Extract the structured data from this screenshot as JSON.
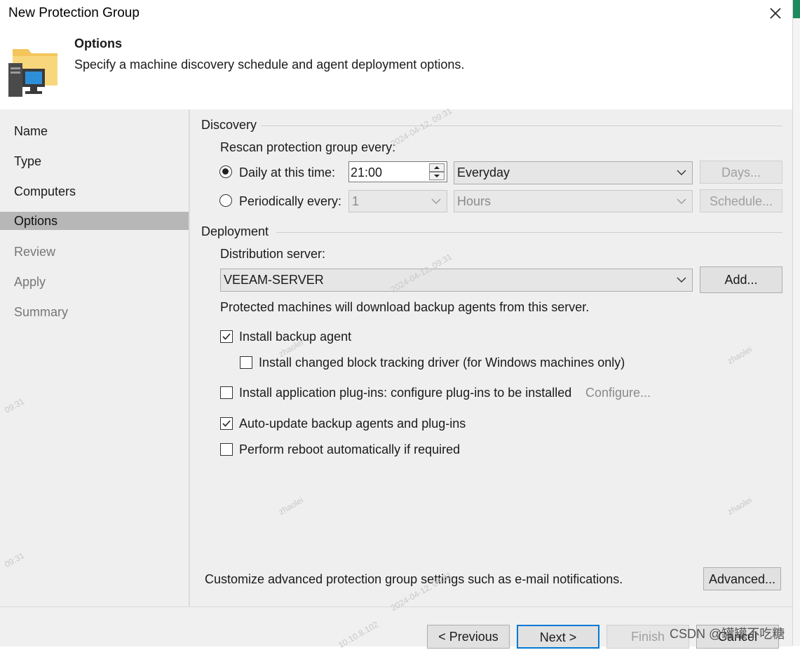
{
  "window": {
    "title": "New Protection Group"
  },
  "header": {
    "title": "Options",
    "subtitle": "Specify a machine discovery schedule and agent deployment options."
  },
  "sidebar": {
    "items": [
      {
        "label": "Name"
      },
      {
        "label": "Type"
      },
      {
        "label": "Computers"
      },
      {
        "label": "Options"
      },
      {
        "label": "Review"
      },
      {
        "label": "Apply"
      },
      {
        "label": "Summary"
      }
    ]
  },
  "discovery": {
    "group_label": "Discovery",
    "rescan_label": "Rescan protection group every:",
    "daily_label": "Daily at this time:",
    "daily_selected": true,
    "time_value": "21:00",
    "days_combo": "Everyday",
    "days_button": "Days...",
    "periodic_label": "Periodically every:",
    "periodic_value": "1",
    "periodic_unit": "Hours",
    "schedule_button": "Schedule..."
  },
  "deployment": {
    "group_label": "Deployment",
    "server_label": "Distribution server:",
    "server_value": "VEEAM-SERVER",
    "add_button": "Add...",
    "note": "Protected machines will download backup agents from this server.",
    "install_agent": {
      "label": "Install backup agent",
      "checked": true
    },
    "install_cbt": {
      "label": "Install changed block tracking driver (for Windows machines only)",
      "checked": false
    },
    "install_plugins": {
      "label": "Install application plug-ins: configure plug-ins to be installed",
      "checked": false
    },
    "configure_link": "Configure...",
    "auto_update": {
      "label": "Auto-update backup agents and plug-ins",
      "checked": true
    },
    "reboot": {
      "label": "Perform reboot automatically if required",
      "checked": false
    }
  },
  "advanced": {
    "note": "Customize advanced protection group settings such as e-mail notifications.",
    "button": "Advanced..."
  },
  "footer": {
    "previous": "< Previous",
    "next": "Next >",
    "finish": "Finish",
    "cancel": "Cancel",
    "credit": "CSDN @罐罐不吃糖"
  },
  "watermark": {
    "user": "zhaolei",
    "ip": "10.10.8.102",
    "stamp": "2024-04-12, 09:31",
    "time": "09:31"
  },
  "colors": {
    "accent": "#0078d4",
    "sidebar_active": "#b7b7b7",
    "panel": "#efefef"
  }
}
